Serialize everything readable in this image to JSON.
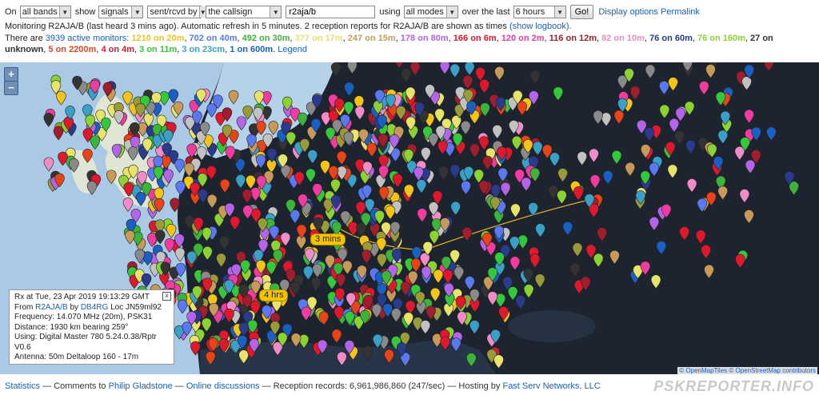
{
  "controls": {
    "on_label": "On",
    "band_select": "all bands",
    "show_label": "show",
    "show_select": "signals",
    "direction_select": "sent/rcvd by",
    "target_select": "the callsign",
    "callsign_value": "r2aja/b",
    "using_label": "using",
    "mode_select": "all modes",
    "over_label": "over the last",
    "period_select": "6 hours",
    "go_label": "Go!",
    "display_options_link": "Display options",
    "permalink_link": "Permalink"
  },
  "status": {
    "text": "Monitoring R2AJA/B (last heard 3 mins ago). Automatic refresh in 5 minutes. 2 reception reports for R2AJA/B are shown as times",
    "logbook_link": "(show logbook)."
  },
  "monitors": {
    "prefix": "There are",
    "count_link": "3939 active monitors:",
    "bands": [
      {
        "text": "1210 on 20m",
        "color": "#f2c418"
      },
      {
        "text": "702 on 40m",
        "color": "#5a78f0"
      },
      {
        "text": "492 on 30m",
        "color": "#3cb43c"
      },
      {
        "text": "377 on 17m",
        "color": "#e8e36a"
      },
      {
        "text": "247 on 15m",
        "color": "#c89a5a"
      },
      {
        "text": "178 on 80m",
        "color": "#b464e6"
      },
      {
        "text": "166 on 6m",
        "color": "#e0182e"
      },
      {
        "text": "120 on 2m",
        "color": "#f03ca0"
      },
      {
        "text": "116 on 12m",
        "color": "#a01e2e"
      },
      {
        "text": "82 on 10m",
        "color": "#f08cc8"
      },
      {
        "text": "76 on 60m",
        "color": "#2a3a8c"
      },
      {
        "text": "76 on 160m",
        "color": "#8cd232"
      },
      {
        "text": "27 on unknown",
        "color": "#333333"
      },
      {
        "text": "5 on 2200m",
        "color": "#e84418"
      },
      {
        "text": "4 on 4m",
        "color": "#e0182e"
      },
      {
        "text": "3 on 11m",
        "color": "#36c83c"
      },
      {
        "text": "3 on 23cm",
        "color": "#3aa0c8"
      },
      {
        "text": "1 on 600m",
        "color": "#1a5fc4"
      }
    ],
    "legend_link": "Legend"
  },
  "map": {
    "zoom_in": "+",
    "zoom_out": "−",
    "time_label_1": "3 mins",
    "time_label_2": "4 hrs",
    "attribution_1": "© OpenMapTiles",
    "attribution_2": "© OpenStreetMap contributors",
    "colors": {
      "sea": "#a9c9e4",
      "land": "#1f2633",
      "uk": "#dfe6d6",
      "path": "#e3b526"
    }
  },
  "popup": {
    "line1": "Rx at Tue, 23 Apr 2019 19:13:29 GMT",
    "from_label": "From",
    "from_call": "R2AJA/B",
    "by_label": "by",
    "by_call": "DB4RG",
    "loc": "Loc JN59ml92",
    "frequency": "Frequency: 14.070 MHz (20m), PSK31",
    "distance": "Distance: 1930 km bearing 259°",
    "using": "Using: Digital Master 780 5.24.0.38/Rptr V0.6",
    "antenna": "Antenna: 50m Deltaloop 160 - 17m",
    "close": "x"
  },
  "footer": {
    "statistics": "Statistics",
    "sep1": "— Comments to",
    "author": "Philip Gladstone",
    "sep2": "—",
    "discussions": "Online discussions",
    "records": "— Reception records: 6,961,986,860 (247/sec) — Hosting by",
    "host": "Fast Serv Networks, LLC",
    "brand": "PSKREPORTER.INFO"
  }
}
